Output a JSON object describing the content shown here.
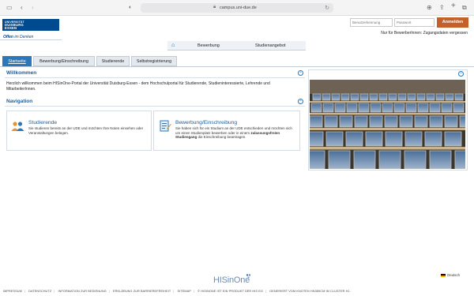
{
  "browser": {
    "url": "campus.uni-due.de"
  },
  "header": {
    "logo_line1": "UNIVERSITÄT",
    "logo_line2": "DUISBURG",
    "logo_line3": "ESSEN",
    "slogan_bold": "Offen",
    "slogan_rest": " im Denken",
    "username_placeholder": "Benutzerkennung",
    "password_placeholder": "Passwort",
    "login_label": "Anmelden",
    "forgot_label": "Nur für BewerberInnen: Zugangsdaten vergessen"
  },
  "topnav": {
    "items": [
      "Bewerbung",
      "Studienangebot"
    ]
  },
  "tabs": [
    {
      "label": "Startseite",
      "active": true
    },
    {
      "label": "Bewerbung/Einschreibung",
      "active": false
    },
    {
      "label": "Studierende",
      "active": false
    },
    {
      "label": "Selbstregistrierung",
      "active": false
    }
  ],
  "welcome": {
    "title": "Willkommen",
    "text": "Herzlich willkommen beim HISinOne-Portal der Universität Duisburg-Essen - dem Hochschulportal für Studierende, Studieninteressierte, Lehrende und MitarbeiterInnen."
  },
  "navigation": {
    "title": "Navigation",
    "cards": [
      {
        "title": "Studierende",
        "desc": "Sie studieren bereits an der UDE und möchten Ihre Noten einsehen oder Veranstaltungen belegen."
      },
      {
        "title": "Bewerbung/Einschreibung",
        "desc_1": "Sie haben sich für ein Studium an der UDE entschieden und möchten sich um einen Studienplatz bewerben oder in einem ",
        "desc_bold": "zulassungsfreien Studiengang",
        "desc_2": " die Einschreibung beantragen."
      }
    ]
  },
  "footer": {
    "language": "Deutsch",
    "brand": "HISinOne",
    "links": [
      "IMPRESSUM",
      "DATENSCHUTZ",
      "INFORMATION ZUR BEDIENUNG",
      "ERKLÄRUNG ZUR BARRIEREFREIHEIT",
      "SITEMAP",
      "© HISINONE IST EIN PRODUKT DER HIS EG",
      "GENERIERT VOM KNOTEN HN389CM IM CLUSTER H1."
    ]
  },
  "colors": {
    "brand_blue": "#004b8f",
    "tab_active": "#2a78b9",
    "login_button": "#c4602a",
    "heading_blue": "#1f5d9a"
  }
}
